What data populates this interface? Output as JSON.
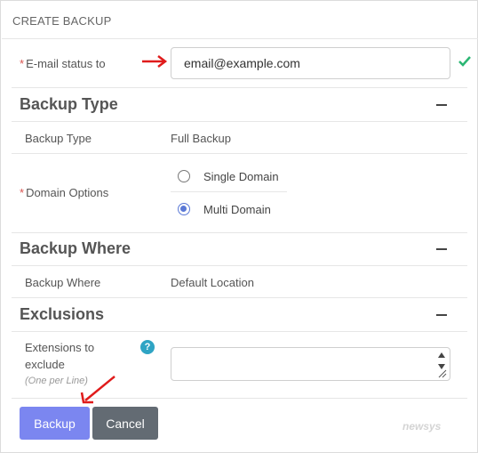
{
  "header": {
    "title": "CREATE BACKUP"
  },
  "email": {
    "label": "E-mail status to",
    "required_mark": "*",
    "value": "email@example.com"
  },
  "backup_type_section": {
    "title": "Backup Type",
    "backup_type_label": "Backup Type",
    "backup_type_value": "Full Backup",
    "domain_options_label": "Domain Options",
    "required_mark": "*",
    "options": [
      {
        "label": "Single Domain",
        "selected": false
      },
      {
        "label": "Multi Domain",
        "selected": true
      }
    ]
  },
  "backup_where_section": {
    "title": "Backup Where",
    "label": "Backup Where",
    "value": "Default Location"
  },
  "exclusions_section": {
    "title": "Exclusions",
    "extensions_label_line1": "Extensions to",
    "extensions_label_line2": "exclude",
    "extensions_hint": "(One per Line)",
    "help_glyph": "?",
    "extensions_value": ""
  },
  "actions": {
    "backup_label": "Backup",
    "cancel_label": "Cancel"
  },
  "watermark": {
    "text": "newsys"
  },
  "colors": {
    "accent": "#7b86f0",
    "radio": "#5b79d6",
    "cancel": "#636b73",
    "success": "#2bb673",
    "arrow": "#e01b1b",
    "help": "#2fa4c4"
  },
  "icons": {
    "valid": "check-icon",
    "annotation": "red-arrow-icon"
  }
}
